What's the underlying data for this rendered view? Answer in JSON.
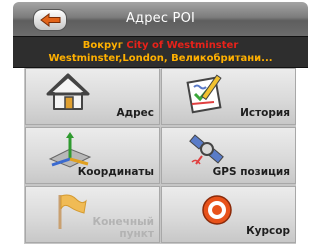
{
  "header": {
    "title": "Адрес POI"
  },
  "search_area": {
    "prefix": "Вокруг",
    "city": "City of Westminster",
    "location": "Westminster,London, Великобритани..."
  },
  "tiles": [
    {
      "label": "Адрес",
      "icon": "house-icon",
      "enabled": true
    },
    {
      "label": "История",
      "icon": "history-notepad-icon",
      "enabled": true
    },
    {
      "label": "Координаты",
      "icon": "coordinates-axes-icon",
      "enabled": true
    },
    {
      "label": "GPS позиция",
      "icon": "satellite-icon",
      "enabled": true
    },
    {
      "label_line1": "Конечный",
      "label_line2": "пункт",
      "icon": "flag-icon",
      "enabled": false
    },
    {
      "label": "Курсор",
      "icon": "target-cursor-icon",
      "enabled": true
    }
  ],
  "colors": {
    "accent_orange": "#ffb000",
    "city_red": "#e8221a",
    "title_text": "#ffffff"
  }
}
